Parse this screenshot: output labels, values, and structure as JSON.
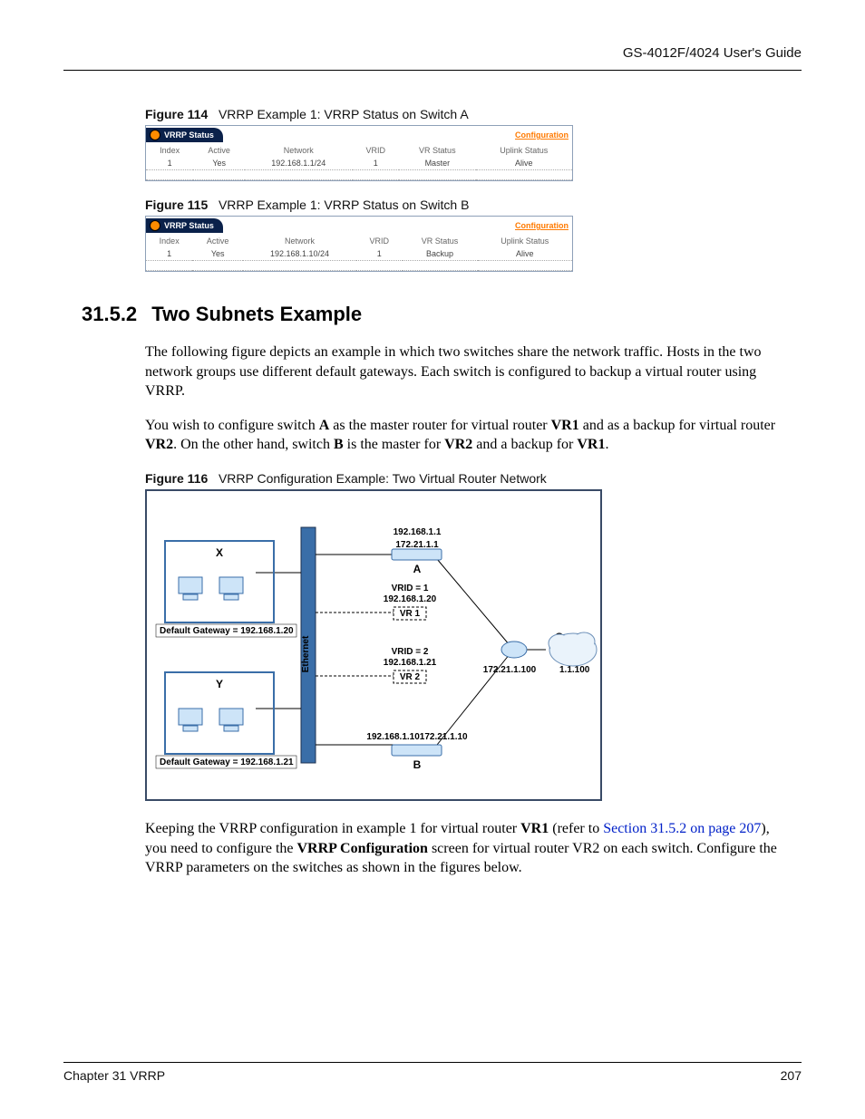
{
  "header": {
    "guide": "GS-4012F/4024 User's Guide"
  },
  "figures": {
    "f114": {
      "label": "Figure 114",
      "title": "VRRP Example 1: VRRP Status on Switch A"
    },
    "f115": {
      "label": "Figure 115",
      "title": "VRRP Example 1: VRRP Status on Switch B"
    },
    "f116": {
      "label": "Figure 116",
      "title": "VRRP Configuration Example: Two Virtual Router Network"
    }
  },
  "vrrp_panel": {
    "title": "VRRP Status",
    "config_link": "Configuration",
    "cols": {
      "index": "Index",
      "active": "Active",
      "network": "Network",
      "vrid": "VRID",
      "vrstatus": "VR Status",
      "uplink": "Uplink Status"
    }
  },
  "table_a": {
    "index": "1",
    "active": "Yes",
    "network": "192.168.1.1/24",
    "vrid": "1",
    "vrstatus": "Master",
    "uplink": "Alive"
  },
  "table_b": {
    "index": "1",
    "active": "Yes",
    "network": "192.168.1.10/24",
    "vrid": "1",
    "vrstatus": "Backup",
    "uplink": "Alive"
  },
  "section": {
    "number": "31.5.2",
    "title": "Two Subnets Example"
  },
  "paragraphs": {
    "p1": "The following figure depicts an example in which two switches share the network traffic. Hosts in the two network groups use different default gateways. Each switch is configured to backup a virtual router using VRRP.",
    "p2a": "You wish to configure switch ",
    "p2_A": "A",
    "p2b": " as the master router for virtual router ",
    "p2_VR1": "VR1",
    "p2c": " and as a backup for virtual router ",
    "p2_VR2": "VR2",
    "p2d": ". On the other hand, switch ",
    "p2_B": "B",
    "p2e": " is the master for ",
    "p2_VR2b": "VR2",
    "p2f": " and a backup for ",
    "p2_VR1b": "VR1",
    "p2g": ".",
    "p3a": "Keeping the VRRP configuration in example 1 for virtual router ",
    "p3_VR1": "VR1",
    "p3b": " (refer to ",
    "p3_link": "Section 31.5.2 on page 207",
    "p3c": "), you need to configure the ",
    "p3_vc": "VRRP Configuration",
    "p3d": " screen for virtual router VR2 on each switch. Configure the VRRP parameters on the switches as shown in the figures below."
  },
  "diagram": {
    "x": "X",
    "y": "Y",
    "a": "A",
    "b": "B",
    "g": "G",
    "ethernet": "Ethernet",
    "gw1": "Default Gateway = 192.168.1.20",
    "gw2": "Default Gateway = 192.168.1.21",
    "ip_a": "192.168.1.1",
    "ip_a2": "172.21.1.1",
    "ip_b": "192.168.1.10",
    "ip_b2": "172.21.1.10",
    "vrid1": "VRID = 1",
    "vrip1": "192.168.1.20",
    "vr1": "VR 1",
    "vrid2": "VRID = 2",
    "vrip2": "192.168.1.21",
    "vr2": "VR 2",
    "wan": "172.21.1.100",
    "wan2": "1.1.100"
  },
  "footer": {
    "left": "Chapter 31 VRRP",
    "right": "207"
  }
}
